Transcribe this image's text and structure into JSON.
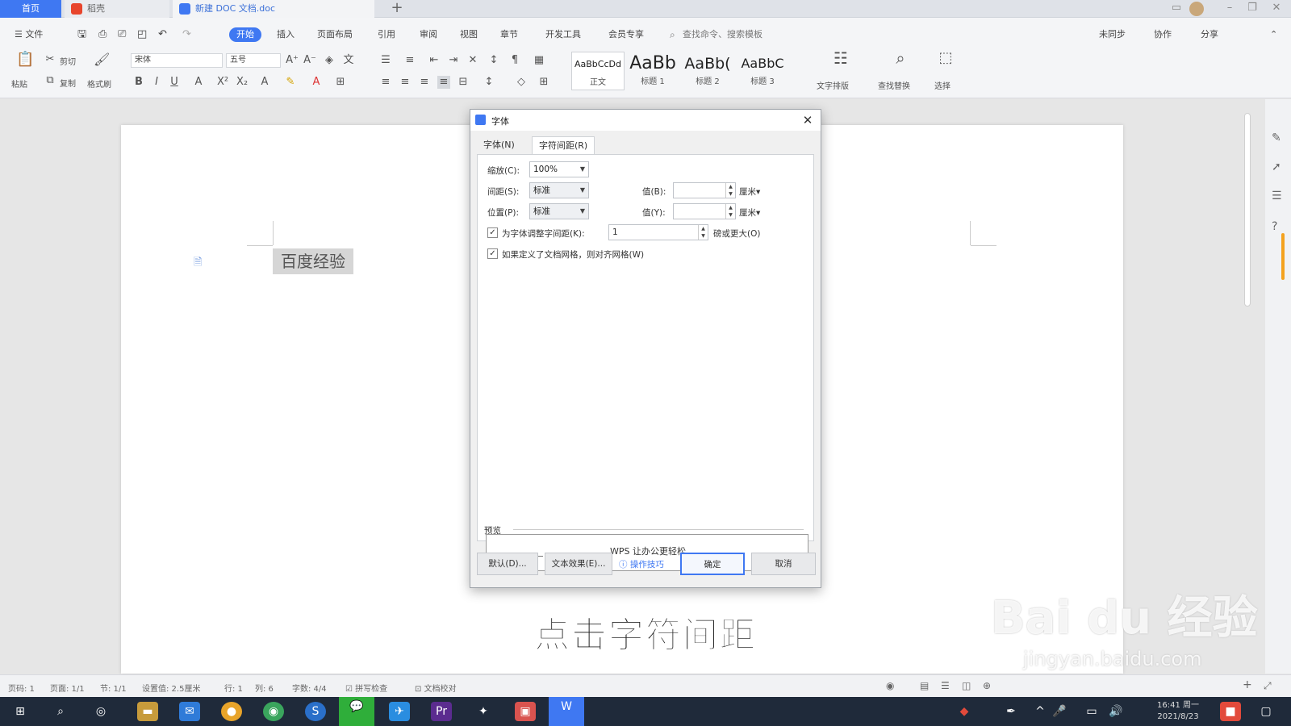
{
  "tabs": {
    "home": "首页",
    "docer": "稻壳",
    "doc": "新建 DOC 文档.doc",
    "plus": "+"
  },
  "menubar": {
    "file": "☰ 文件",
    "items": [
      "开始",
      "插入",
      "页面布局",
      "引用",
      "审阅",
      "视图",
      "章节",
      "开发工具",
      "会员专享"
    ],
    "search_placeholder": "查找命令、搜索模板",
    "right": [
      "未同步",
      "协作",
      "分享"
    ]
  },
  "ribbon": {
    "paste": "粘贴",
    "cut": "剪切",
    "copy": "复制",
    "format_painter": "格式刷",
    "font_name": "宋体",
    "font_size": "五号",
    "styles": [
      {
        "sample": "AaBbCcDd",
        "label": "正文"
      },
      {
        "sample": "AaBb",
        "label": "标题 1"
      },
      {
        "sample": "AaBb(",
        "label": "标题 2"
      },
      {
        "sample": "AaBbC",
        "label": "标题 3"
      }
    ],
    "text_layout": "文字排版",
    "find_replace": "查找替换",
    "select": "选择"
  },
  "document": {
    "text": "百度经验"
  },
  "dialog": {
    "title": "字体",
    "tabs": [
      "字体(N)",
      "字符间距(R)"
    ],
    "scale_label": "缩放(C):",
    "scale_value": "100%",
    "spacing_label": "间距(S):",
    "spacing_value": "标准",
    "position_label": "位置(P):",
    "position_value": "标准",
    "value_b_label": "值(B):",
    "value_y_label": "值(Y):",
    "unit": "厘米",
    "kerning_label": "为字体调整字间距(K):",
    "kerning_value": "1",
    "kerning_suffix": "磅或更大(O)",
    "grid_label": "如果定义了文档网格，则对齐网格(W)",
    "preview_label": "预览",
    "preview_text": "WPS 让办公更轻松",
    "buttons": {
      "default": "默认(D)...",
      "text_effect": "文本效果(E)...",
      "tips": "操作技巧",
      "ok": "确定",
      "cancel": "取消"
    }
  },
  "subtitle": "点击字符间距",
  "watermark": {
    "main": "Bai du 经验",
    "sub": "jingyan.baidu.com"
  },
  "statusbar": {
    "items": [
      "页码: 1",
      "页面: 1/1",
      "节: 1/1",
      "设置值: 2.5厘米",
      "行: 1",
      "列: 6",
      "字数: 4/4",
      "拼写检查",
      "文档校对"
    ]
  },
  "taskbar": {
    "time": "16:41 周一",
    "date": "2021/8/23"
  }
}
